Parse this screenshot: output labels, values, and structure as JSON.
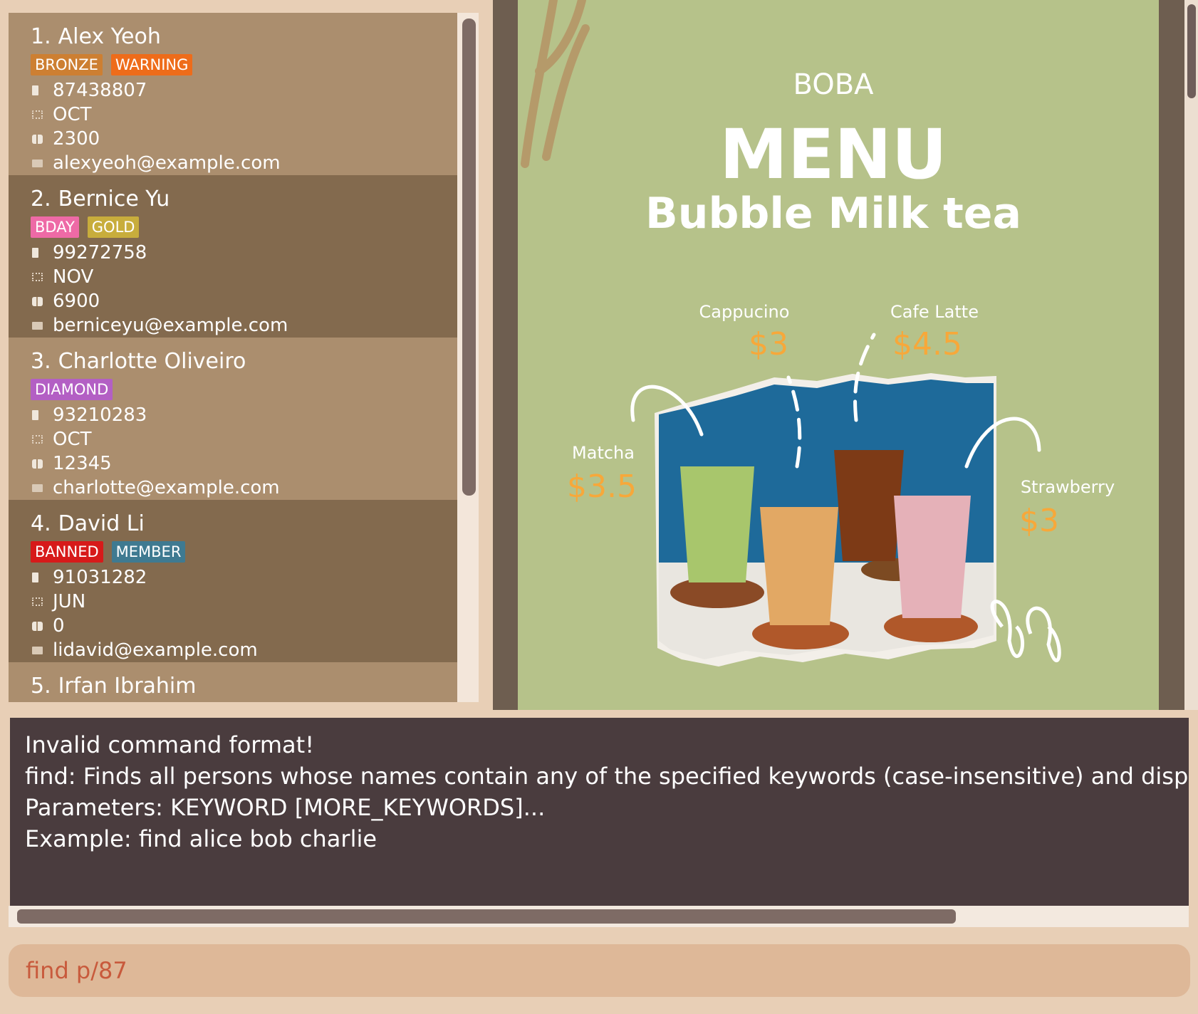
{
  "persons": [
    {
      "index": "1.",
      "name": "Alex Yeoh",
      "tags": [
        {
          "label": "BRONZE",
          "color": "#cd7f32"
        },
        {
          "label": "WARNING",
          "color": "#ee6c1a"
        }
      ],
      "phone": "87438807",
      "birthday_month": "OCT",
      "points": "2300",
      "email": "alexyeoh@example.com"
    },
    {
      "index": "2.",
      "name": "Bernice Yu",
      "tags": [
        {
          "label": "BDAY",
          "color": "#ee6aa6"
        },
        {
          "label": "GOLD",
          "color": "#c8ad3c"
        }
      ],
      "phone": "99272758",
      "birthday_month": "NOV",
      "points": "6900",
      "email": "berniceyu@example.com"
    },
    {
      "index": "3.",
      "name": "Charlotte Oliveiro",
      "tags": [
        {
          "label": "DIAMOND",
          "color": "#b35fc4"
        }
      ],
      "phone": "93210283",
      "birthday_month": "OCT",
      "points": "12345",
      "email": "charlotte@example.com"
    },
    {
      "index": "4.",
      "name": "David Li",
      "tags": [
        {
          "label": "BANNED",
          "color": "#d71a1a"
        },
        {
          "label": "MEMBER",
          "color": "#3f7a91"
        }
      ],
      "phone": "91031282",
      "birthday_month": "JUN",
      "points": "0",
      "email": "lidavid@example.com"
    },
    {
      "index": "5.",
      "name": "Irfan Ibrahim",
      "tags": [],
      "phone": "",
      "birthday_month": "",
      "points": "",
      "email": ""
    }
  ],
  "menu_image": {
    "brand": "BOBA",
    "title": "MENU",
    "subtitle": "Bubble Milk tea",
    "items": [
      {
        "name": "Cappucino",
        "price": "$3"
      },
      {
        "name": "Cafe Latte",
        "price": "$4.5"
      },
      {
        "name": "Matcha",
        "price": "$3.5"
      },
      {
        "name": "Strawberry",
        "price": "$3"
      }
    ]
  },
  "result": {
    "lines": [
      "Invalid command format!",
      "find: Finds all persons whose names contain any of the specified keywords (case-insensitive) and displays them as a list with index numbers.",
      "Parameters: KEYWORD [MORE_KEYWORDS]...",
      "Example: find alice bob charlie"
    ]
  },
  "command": {
    "value": "find p/87"
  },
  "icons": {
    "phone": "phone-icon",
    "birthday": "calendar-icon",
    "points": "gift-icon",
    "email": "mail-icon"
  }
}
